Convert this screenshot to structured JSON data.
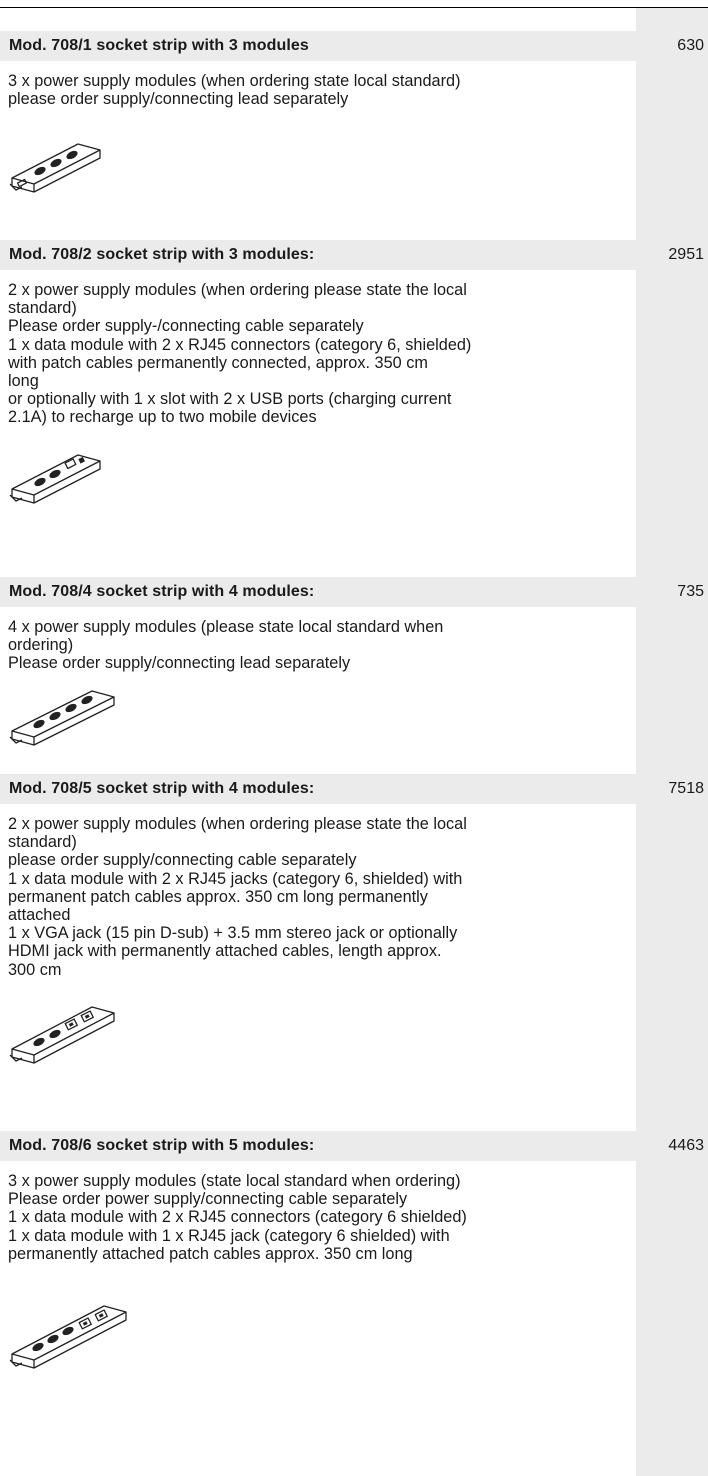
{
  "products": [
    {
      "title": "Mod. 708/1 socket strip with 3 modules",
      "price": "630",
      "lines": [
        "3 x power supply modules (when ordering state local standard)",
        "please order supply/connecting lead separately"
      ],
      "image_icon": "socket-strip-3-power-icon"
    },
    {
      "title": "Mod. 708/2 socket strip with 3 modules:",
      "price": "2951",
      "lines": [
        "2 x power supply modules (when ordering please state the local",
        "standard)",
        "Please order supply-/connecting cable separately",
        "1 x data module with 2 x RJ45 connectors (category 6, shielded)",
        "with patch cables permanently connected, approx. 350 cm",
        "long",
        "or optionally with 1 x slot with 2 x USB ports (charging current",
        "2.1A) to recharge up to two mobile devices"
      ],
      "image_icon": "socket-strip-2-power-1-data-icon"
    },
    {
      "title": "Mod. 708/4 socket strip with 4 modules:",
      "price": "735",
      "lines": [
        "4 x power supply modules (please state local standard when",
        "ordering)",
        "Please order supply/connecting lead separately"
      ],
      "image_icon": "socket-strip-4-power-icon"
    },
    {
      "title": "Mod. 708/5 socket strip with 4 modules:",
      "price": "7518",
      "lines": [
        "2 x power supply modules (when ordering please state the local",
        "standard)",
        "please order supply/connecting cable separately",
        "1 x data module with 2 x RJ45 jacks (category 6, shielded) with",
        "permanent patch cables approx. 350 cm long permanently",
        "attached",
        "1 x VGA jack (15 pin D-sub) + 3.5 mm stereo jack or optionally",
        "HDMI jack with permanently attached cables, length approx.",
        "300 cm"
      ],
      "image_icon": "socket-strip-2-power-2-data-icon"
    },
    {
      "title": "Mod. 708/6 socket strip with 5 modules:",
      "price": "4463",
      "lines": [
        "3 x power supply modules (state local standard when ordering)",
        "Please order power supply/connecting cable separately",
        "1 x data module with 2 x RJ45 connectors (category 6 shielded)",
        "1 x data module with 1 x RJ45 jack (category 6 shielded) with",
        "permanently attached patch cables approx. 350 cm long"
      ],
      "image_icon": "socket-strip-3-power-2-data-icon"
    }
  ]
}
